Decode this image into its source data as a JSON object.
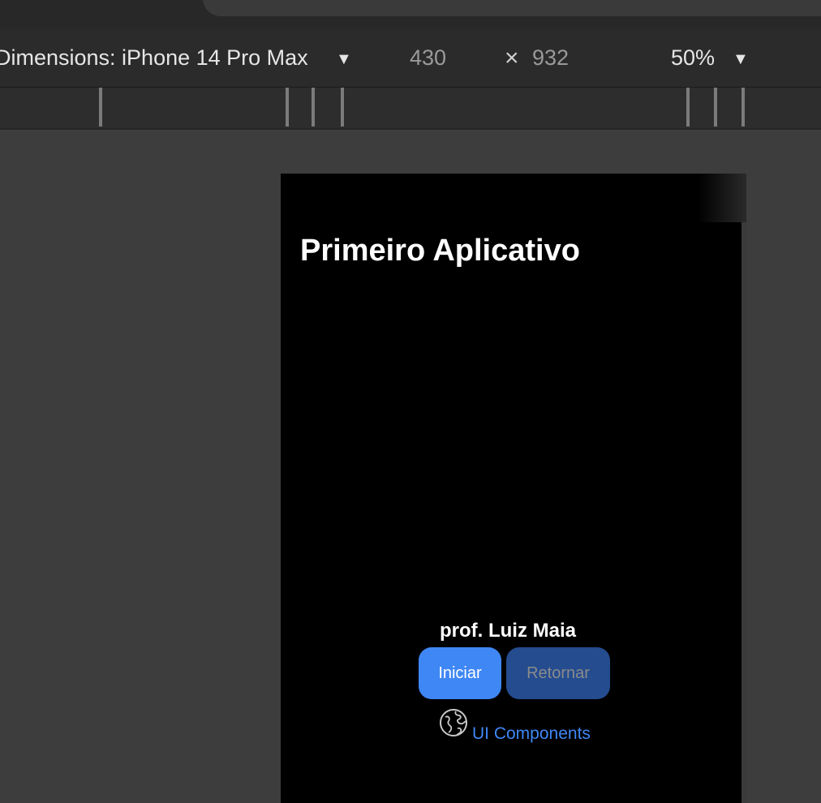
{
  "toolbar": {
    "dimensions_label": "Dimensions: iPhone 14 Pro Max",
    "dimensions_caret": "▼",
    "width": "430",
    "times": "×",
    "height": "932",
    "zoom": "50%",
    "zoom_caret": "▼"
  },
  "app": {
    "title": "Primeiro Aplicativo",
    "author": "prof. Luiz Maia",
    "start_button": "Iniciar",
    "back_button": "Retornar",
    "globe_icon": "globe-icon",
    "link_text": "UI Components"
  },
  "colors": {
    "accent": "#3f87f5",
    "disabled_button": "#244c8f",
    "device_background": "#000000"
  }
}
